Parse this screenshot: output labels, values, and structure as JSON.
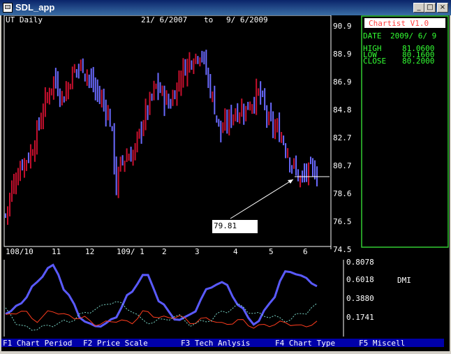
{
  "window": {
    "title": "SDL_app",
    "controls": {
      "minimize": "_",
      "maximize": "□",
      "close": "×"
    }
  },
  "chart_header": {
    "symbol_label": "UT Daily",
    "date_from": "21/ 6/2007",
    "to_label": "to",
    "date_to": "9/ 6/2009"
  },
  "info_panel": {
    "title": "Chartist V1.0",
    "date_label": "DATE",
    "date_value": "2009/ 6/ 9",
    "high_label": "HIGH",
    "high_value": "81.0600",
    "low_label": "LOW",
    "low_value": "80.1600",
    "close_label": "CLOSE",
    "close_value": "80.2000"
  },
  "price_axis": [
    "90.9",
    "88.9",
    "86.9",
    "84.8",
    "82.7",
    "80.7",
    "78.6",
    "76.5",
    "74.5"
  ],
  "time_axis": [
    "108/10",
    "11",
    "12",
    "109/ 1",
    "2",
    "3",
    "4",
    "5",
    "6"
  ],
  "cursor_tooltip": "79.81",
  "dmi": {
    "label": "DMI",
    "axis": [
      "0.8078",
      "0.6018",
      "0.3880",
      "0.1741"
    ]
  },
  "function_keys": [
    {
      "key": "F1",
      "label": "Chart Period"
    },
    {
      "key": "F2",
      "label": "Price Scale"
    },
    {
      "key": "F3",
      "label": "Tech Anlysis"
    },
    {
      "key": "F4",
      "label": "Chart Type"
    },
    {
      "key": "F5",
      "label": "Miscell"
    }
  ],
  "colors": {
    "background": "#000000",
    "up_bar": "#c8102e",
    "down_bar": "#6a6aff",
    "panel_border": "#33cc33",
    "panel_text": "#33ff33",
    "panel_title": "#ff4040",
    "fkey_bar": "#0000a8",
    "dmi_adx": "#5a5aff",
    "dmi_plus": "#ff3c1e",
    "dmi_minus": "#7ad6c8"
  },
  "chart_data": [
    {
      "type": "candlestick",
      "title": "UT Daily",
      "period": [
        "21/ 6/2007",
        "9/ 6/2009"
      ],
      "ylim": [
        74.5,
        90.9
      ],
      "y_ticks": [
        90.9,
        88.9,
        86.9,
        84.8,
        82.7,
        80.7,
        78.6,
        76.5,
        74.5
      ],
      "x_ticks": [
        "108/10",
        "11",
        "12",
        "109/ 1",
        "2",
        "3",
        "4",
        "5",
        "6"
      ],
      "close_path": [
        [
          0,
          77.0
        ],
        [
          0.02,
          79.0
        ],
        [
          0.05,
          80.8
        ],
        [
          0.08,
          81.5
        ],
        [
          0.12,
          85.0
        ],
        [
          0.15,
          87.0
        ],
        [
          0.18,
          85.5
        ],
        [
          0.21,
          87.5
        ],
        [
          0.24,
          88.0
        ],
        [
          0.27,
          86.5
        ],
        [
          0.31,
          85.0
        ],
        [
          0.33,
          83.5
        ],
        [
          0.345,
          79.0
        ],
        [
          0.36,
          81.0
        ],
        [
          0.4,
          81.5
        ],
        [
          0.43,
          84.0
        ],
        [
          0.47,
          86.5
        ],
        [
          0.51,
          85.0
        ],
        [
          0.55,
          87.5
        ],
        [
          0.58,
          88.5
        ],
        [
          0.61,
          89.0
        ],
        [
          0.64,
          86.0
        ],
        [
          0.67,
          83.0
        ],
        [
          0.71,
          84.5
        ],
        [
          0.75,
          84.8
        ],
        [
          0.79,
          86.0
        ],
        [
          0.82,
          83.8
        ],
        [
          0.86,
          82.8
        ],
        [
          0.89,
          80.8
        ],
        [
          0.92,
          79.5
        ],
        [
          0.94,
          80.2
        ],
        [
          0.97,
          80.2
        ]
      ],
      "cursor_value": 79.81,
      "last_bar": {
        "date": "2009/ 6/ 9",
        "high": 81.06,
        "low": 80.16,
        "close": 80.2
      }
    },
    {
      "type": "line",
      "title": "DMI",
      "ylim": [
        0.1741,
        0.8078
      ],
      "y_ticks": [
        0.8078,
        0.6018,
        0.388,
        0.1741
      ],
      "x": [
        0,
        0.05,
        0.1,
        0.15,
        0.2,
        0.25,
        0.3,
        0.35,
        0.4,
        0.45,
        0.5,
        0.55,
        0.6,
        0.65,
        0.7,
        0.75,
        0.8,
        0.85,
        0.9,
        0.95,
        1.0
      ],
      "series": [
        {
          "name": "",
          "values": [
            0.32,
            0.42,
            0.62,
            0.78,
            0.5,
            0.25,
            0.2,
            0.28,
            0.52,
            0.7,
            0.42,
            0.26,
            0.32,
            0.56,
            0.62,
            0.4,
            0.22,
            0.42,
            0.72,
            0.68,
            0.58
          ]
        },
        {
          "name": "",
          "values": [
            0.3,
            0.35,
            0.26,
            0.35,
            0.3,
            0.28,
            0.22,
            0.26,
            0.24,
            0.34,
            0.28,
            0.3,
            0.24,
            0.28,
            0.22,
            0.26,
            0.2,
            0.22,
            0.24,
            0.2,
            0.24
          ]
        },
        {
          "name": "",
          "values": [
            0.36,
            0.2,
            0.18,
            0.22,
            0.25,
            0.32,
            0.38,
            0.44,
            0.36,
            0.24,
            0.26,
            0.3,
            0.22,
            0.26,
            0.34,
            0.4,
            0.32,
            0.3,
            0.26,
            0.32,
            0.4
          ]
        }
      ]
    }
  ]
}
